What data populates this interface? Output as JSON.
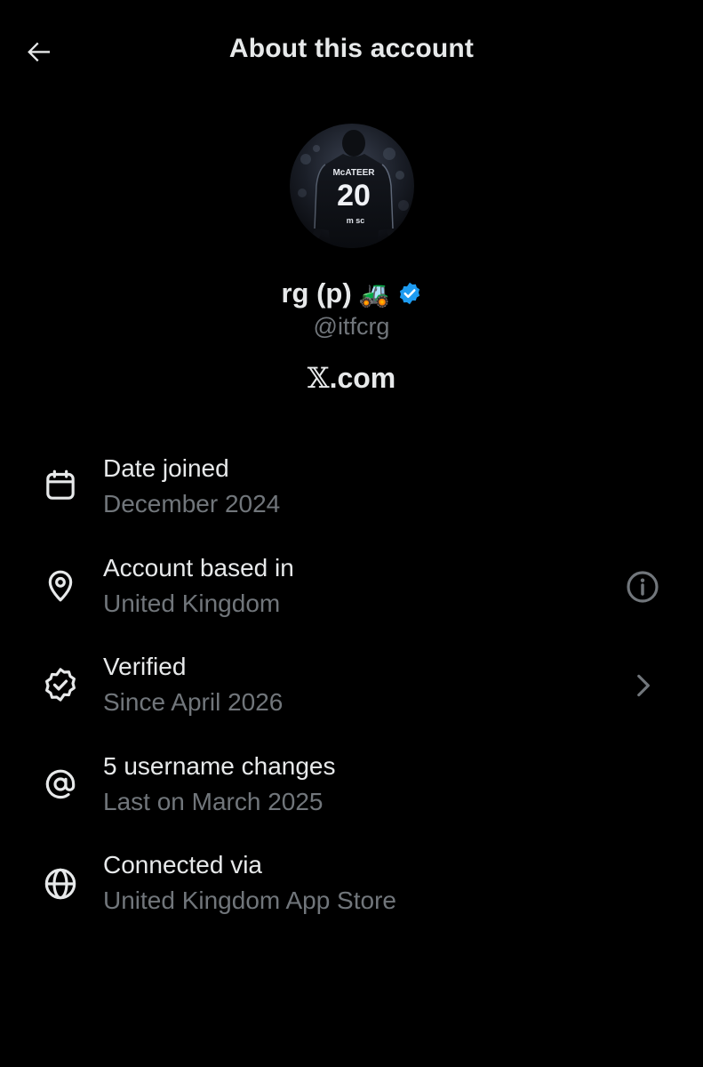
{
  "header": {
    "title": "About this account",
    "back_icon": "arrow-left-icon"
  },
  "profile": {
    "display_name": "rg (p)",
    "emoji": "🚜",
    "verified_icon": "verified-badge-icon",
    "verified_color": "#1d9bf0",
    "handle": "@itfcrg",
    "site_prefix": "𝕏",
    "site_suffix": ".com",
    "avatar": {
      "jersey_name": "McATEER",
      "jersey_number": "20",
      "sponsor": "m sc"
    }
  },
  "details": [
    {
      "icon": "calendar-icon",
      "title": "Date joined",
      "subtitle": "December 2024",
      "right_icon": null
    },
    {
      "icon": "location-pin-icon",
      "title": "Account based in",
      "subtitle": "United Kingdom",
      "right_icon": "info-icon"
    },
    {
      "icon": "verified-outline-icon",
      "title": "Verified",
      "subtitle": "Since April 2026",
      "right_icon": "chevron-right-icon"
    },
    {
      "icon": "at-sign-icon",
      "title": "5 username changes",
      "subtitle": "Last on March 2025",
      "right_icon": null
    },
    {
      "icon": "globe-icon",
      "title": "Connected via",
      "subtitle": "United Kingdom App Store",
      "right_icon": null
    }
  ],
  "colors": {
    "background": "#000000",
    "primary_text": "#e7e9ea",
    "secondary_text": "#71767b",
    "accent": "#1d9bf0"
  }
}
